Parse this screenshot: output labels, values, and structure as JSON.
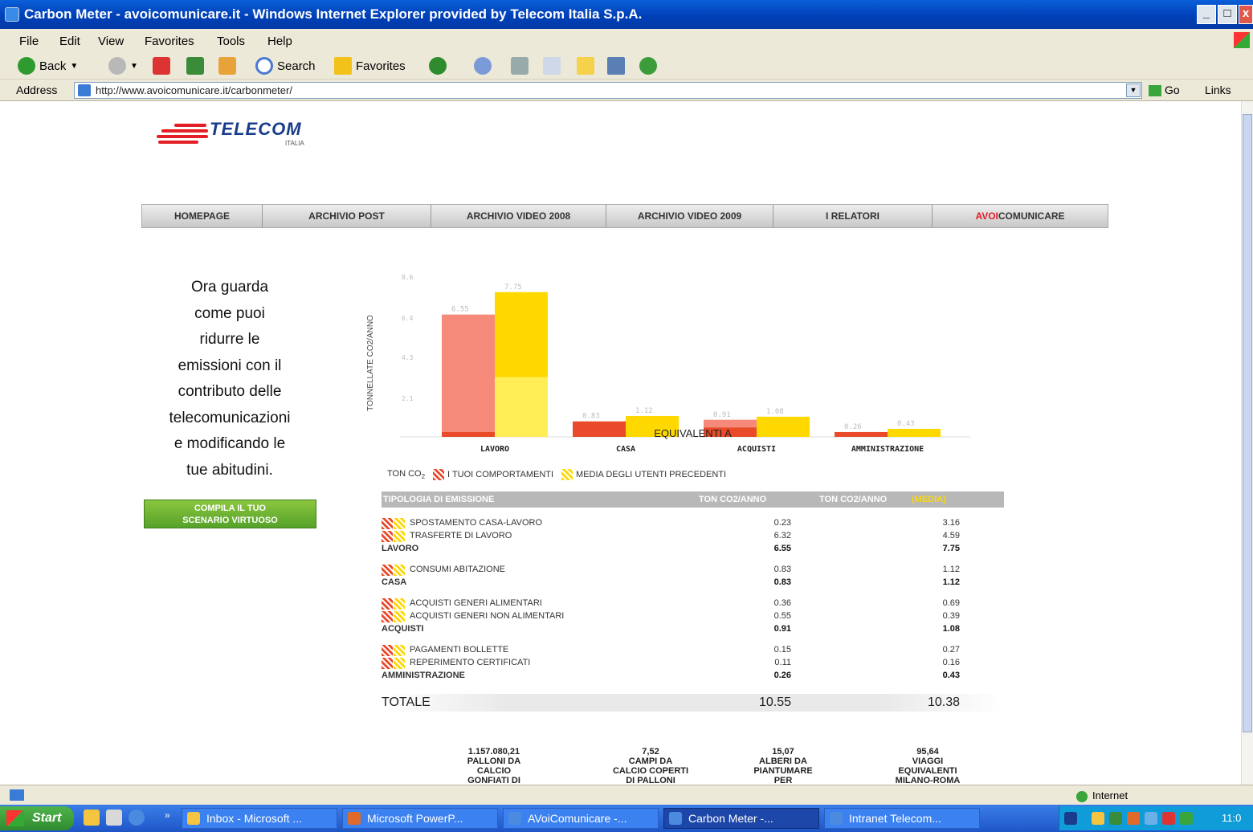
{
  "window": {
    "title": "Carbon Meter - avoicomunicare.it - Windows Internet Explorer provided by Telecom Italia S.p.A.",
    "controls": [
      "_",
      "□",
      "x"
    ]
  },
  "menu": [
    "File",
    "Edit",
    "View",
    "Favorites",
    "Tools",
    "Help"
  ],
  "toolbar": {
    "back": "Back",
    "search": "Search",
    "favorites": "Favorites"
  },
  "address": {
    "label": "Address",
    "url": "http://www.avoicomunicare.it/carbonmeter/",
    "go": "Go",
    "links": "Links"
  },
  "logo": {
    "brand": "TELECOM",
    "sub": "ITALIA"
  },
  "nav": [
    {
      "label": "HOMEPAGE"
    },
    {
      "label": "ARCHIVIO POST"
    },
    {
      "label": "ARCHIVIO VIDEO 2008"
    },
    {
      "label": "ARCHIVIO VIDEO 2009"
    },
    {
      "label": "I RELATORI"
    },
    {
      "label": "AVOICOMUNICARE",
      "prefix": "A",
      "accent": "VOI",
      "suffix": "COMUNICARE"
    }
  ],
  "intro": [
    "Ora guarda",
    "come puoi",
    "ridurre le",
    "emissioni con il",
    "contributo delle",
    "telecomunicazioni",
    "e modificando le",
    "tue abitudini."
  ],
  "cta": [
    "COMPILA IL TUO",
    "SCENARIO VIRTUOSO"
  ],
  "chart_data": {
    "type": "bar",
    "ylabel": "TONNELLATE CO2/ANNO",
    "categories": [
      "LAVORO",
      "CASA",
      "ACQUISTI",
      "AMMINISTRAZIONE"
    ],
    "series": [
      {
        "name": "I TUOI COMPORTAMENTI",
        "values": [
          6.55,
          0.83,
          0.91,
          0.26
        ]
      },
      {
        "name": "MEDIA DEGLI UTENTI PRECEDENTI",
        "values": [
          7.75,
          1.12,
          1.08,
          0.43
        ]
      }
    ],
    "bar_labels": [
      [
        "6.55",
        "7.75"
      ],
      [
        "0.83",
        "1.12"
      ],
      [
        "0.91",
        "1.08"
      ],
      [
        "0.26",
        "0.43"
      ]
    ],
    "yticks": [
      "8.6",
      "6.4",
      "4.3",
      "2.1"
    ],
    "ylim": [
      0,
      8.6
    ],
    "legend_prefix": "TON CO",
    "colors": {
      "you": "#e84a2a",
      "you_light": "#f58a7a",
      "avg": "#ffd800",
      "avg_light": "#ffee55"
    }
  },
  "table": {
    "header": {
      "col1": "TIPOLOGIA DI EMISSIONE",
      "col2": "TON CO2/ANNO",
      "col3": "TON CO2/ANNO",
      "col3_note": "(MEDIA)"
    },
    "groups": [
      {
        "rows": [
          [
            "SPOSTAMENTO CASA-LAVORO",
            "0.23",
            "3.16"
          ],
          [
            "TRASFERTE DI LAVORO",
            "6.32",
            "4.59"
          ]
        ],
        "total": [
          "LAVORO",
          "6.55",
          "7.75"
        ]
      },
      {
        "rows": [
          [
            "CONSUMI ABITAZIONE",
            "0.83",
            "1.12"
          ]
        ],
        "total": [
          "CASA",
          "0.83",
          "1.12"
        ]
      },
      {
        "rows": [
          [
            "ACQUISTI GENERI ALIMENTARI",
            "0.36",
            "0.69"
          ],
          [
            "ACQUISTI GENERI NON ALIMENTARI",
            "0.55",
            "0.39"
          ]
        ],
        "total": [
          "ACQUISTI",
          "0.91",
          "1.08"
        ]
      },
      {
        "rows": [
          [
            "PAGAMENTI BOLLETTE",
            "0.15",
            "0.27"
          ],
          [
            "REPERIMENTO CERTIFICATI",
            "0.11",
            "0.16"
          ]
        ],
        "total": [
          "AMMINISTRAZIONE",
          "0.26",
          "0.43"
        ]
      }
    ],
    "grand_total": {
      "label": "TOTALE",
      "v1": "10.55",
      "v2": "10.38"
    },
    "equiv_title": "EQUIVALENTI A",
    "equivalents": [
      [
        "1.157.080,21",
        "PALLONI DA",
        "CALCIO",
        "GONFIATI DI"
      ],
      [
        "7,52",
        "CAMPI DA",
        "CALCIO COPERTI",
        "DI PALLONI"
      ],
      [
        "15,07",
        "ALBERI DA",
        "PIANTUMARE",
        "PER"
      ],
      [
        "95,64",
        "VIAGGI",
        "EQUIVALENTI",
        "MILANO-ROMA"
      ]
    ]
  },
  "status": {
    "zone": "Internet"
  },
  "taskbar": {
    "start": "Start",
    "buttons": [
      "Inbox - Microsoft ...",
      "Microsoft PowerP...",
      "AVoiComunicare -...",
      "Carbon Meter -...",
      "Intranet Telecom..."
    ],
    "active_index": 3,
    "clock": "11:0"
  }
}
